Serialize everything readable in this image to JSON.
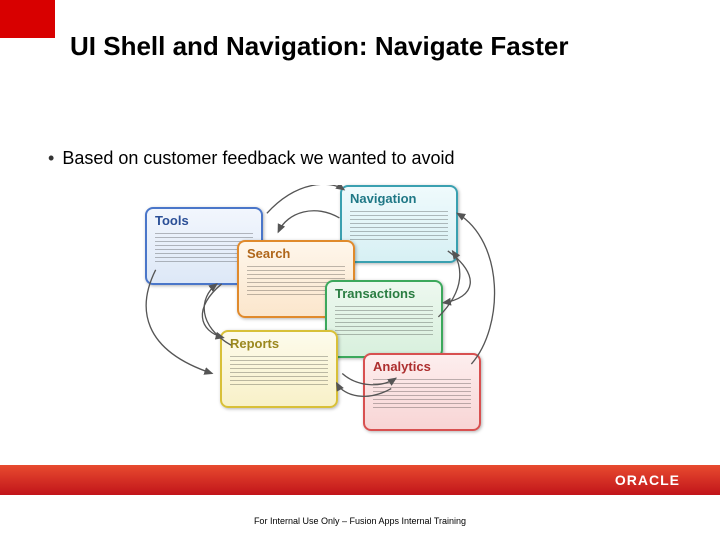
{
  "title": "UI Shell and Navigation: Navigate Faster",
  "bullet": "Based on customer feedback we wanted to avoid",
  "cards": {
    "tools": "Tools",
    "navigation": "Navigation",
    "search": "Search",
    "transactions": "Transactions",
    "reports": "Reports",
    "analytics": "Analytics"
  },
  "logo": "ORACLE",
  "footer": "For Internal Use Only – Fusion Apps Internal Training"
}
